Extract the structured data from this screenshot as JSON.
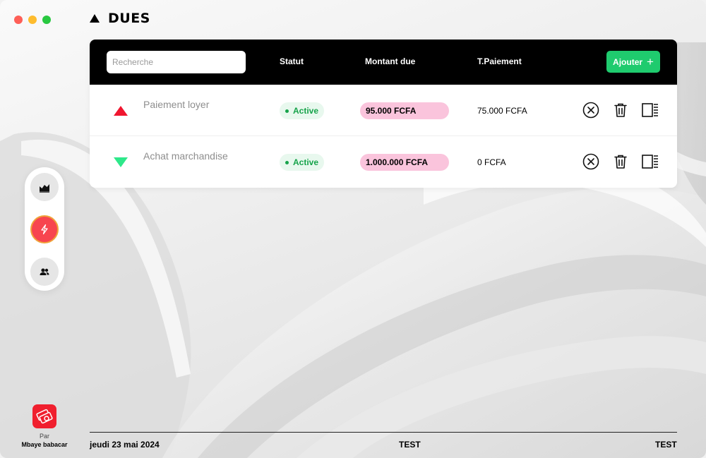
{
  "page": {
    "title": "DUES"
  },
  "colors": {
    "accent_green": "#1fcb6e",
    "active_red": "#f7454f",
    "amount_pink": "#fac4dc",
    "status_green": "#16a34a",
    "header_black": "#000000"
  },
  "table": {
    "search_placeholder": "Recherche",
    "headers": {
      "statut": "Statut",
      "montant": "Montant due",
      "tpaiement": "T.Paiement"
    },
    "add_label": "Ajouter",
    "rows": [
      {
        "direction": "up",
        "name": "Paiement loyer",
        "status": "Active",
        "amount": "95.000 FCFA",
        "tpaiement": "75.000 FCFA"
      },
      {
        "direction": "down",
        "name": "Achat marchandise",
        "status": "Active",
        "amount": "1.000.000 FCFA",
        "tpaiement": "0 FCFA"
      }
    ],
    "row_actions": [
      "cancel-icon",
      "trash-icon",
      "detail-panel-icon"
    ]
  },
  "sidebar": {
    "items": [
      {
        "icon": "chart-area-icon",
        "active": false
      },
      {
        "icon": "bolt-icon",
        "active": true
      },
      {
        "icon": "users-icon",
        "active": false
      }
    ]
  },
  "brand": {
    "by": "Par",
    "name": "Mbaye babacar"
  },
  "footer": {
    "date": "jeudi 23 mai 2024",
    "middle": "TEST",
    "right": "TEST"
  }
}
